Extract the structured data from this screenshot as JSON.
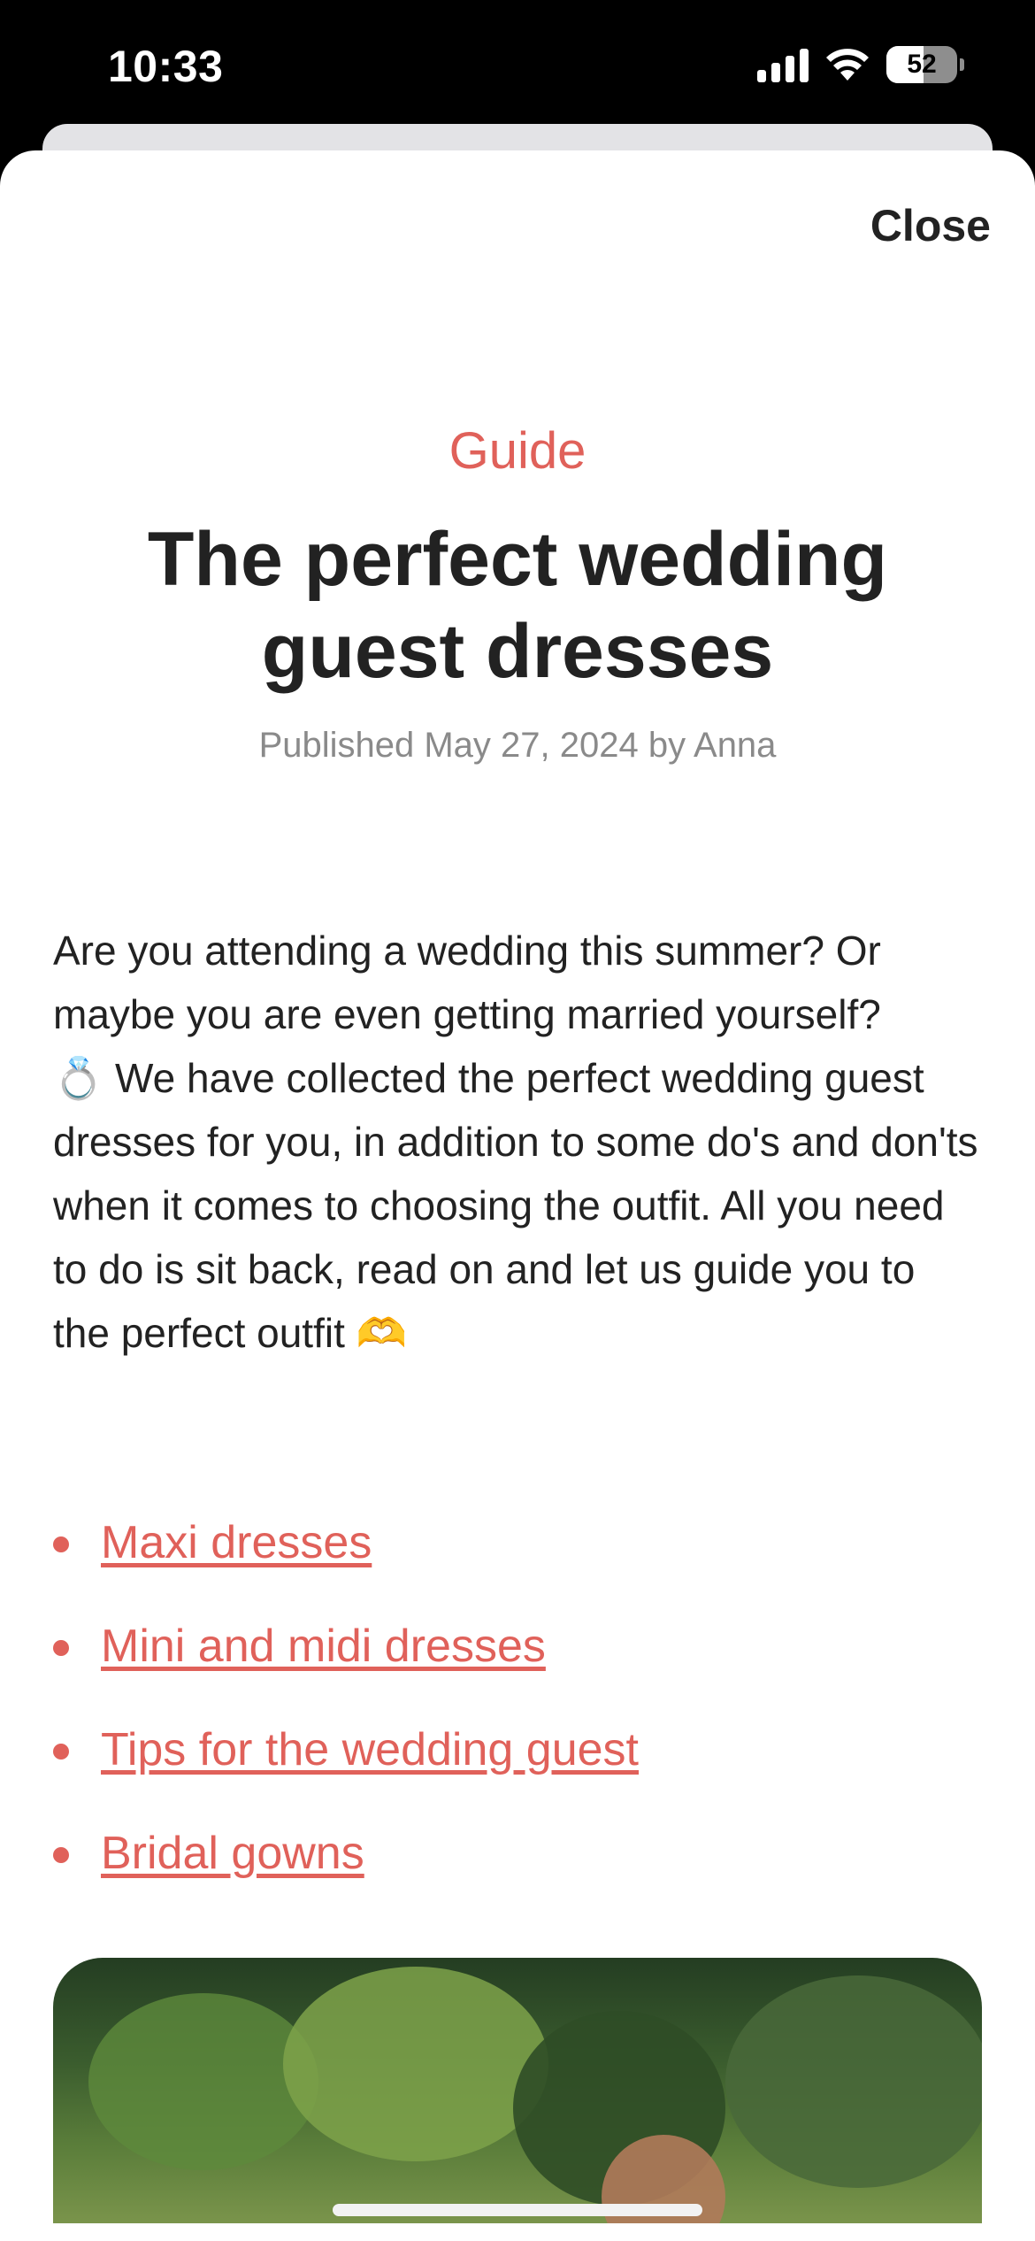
{
  "status_bar": {
    "time": "10:33",
    "battery": "52",
    "battery_level": 0.52,
    "icons": [
      "signal-icon",
      "wifi-icon",
      "battery-icon"
    ]
  },
  "sheet": {
    "close_label": "Close"
  },
  "article": {
    "category": "Guide",
    "title": "The perfect wedding guest dresses",
    "meta": "Published May 27, 2024 by Anna",
    "intro_part1": "Are you attending a wedding this summer? Or maybe you are even getting married yourself?",
    "ring_emoji": "💍",
    "intro_part2": " We have collected the perfect wedding guest dresses for you, in addition to some do's and don'ts when it comes to choosing the outfit. All you need to do is sit back, read on and let us guide you to the perfect outfit ",
    "heart_hands_emoji": "🫶",
    "toc": [
      {
        "label": "Maxi dresses"
      },
      {
        "label": "Mini and midi dresses"
      },
      {
        "label": "Tips for the wedding guest"
      },
      {
        "label": "Bridal gowns"
      }
    ]
  },
  "colors": {
    "accent": "#e0615a",
    "text": "#222222",
    "muted": "#8a8a8a"
  }
}
